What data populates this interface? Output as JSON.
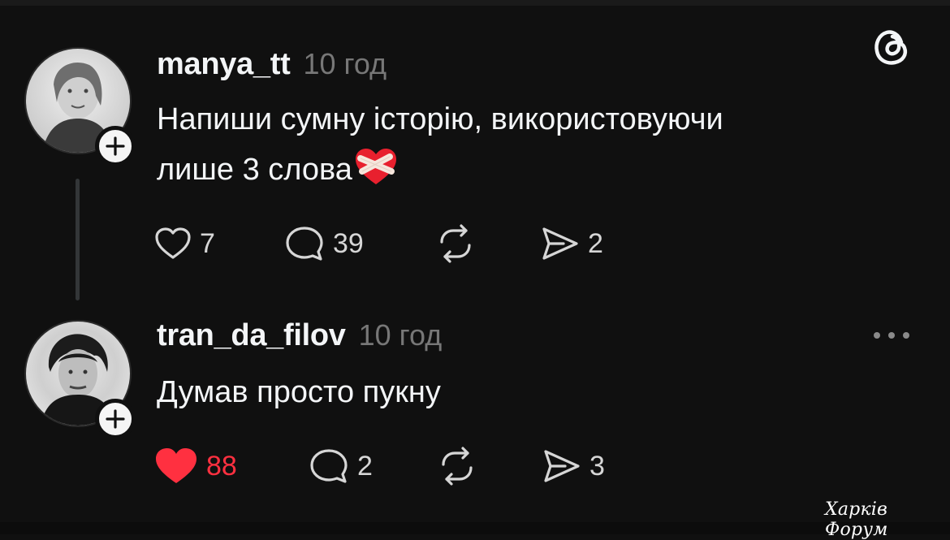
{
  "posts": [
    {
      "username": "manya_tt",
      "time": "10 год",
      "text_line1": "Напиши сумну історію, використовуючи",
      "text_line2": "лише 3 слова",
      "likes": "7",
      "replies": "39",
      "shares": "2",
      "liked": false
    },
    {
      "username": "tran_da_filov",
      "time": "10 год",
      "text": "Думав просто пукну",
      "likes": "88",
      "replies": "2",
      "shares": "3",
      "liked": true
    }
  ],
  "watermark": "Харків Форум",
  "colors": {
    "background": "#101010",
    "text": "#f3f5f7",
    "muted": "#777777",
    "like_active": "#ff3040"
  },
  "icons": [
    "threads-logo-icon",
    "heart-icon",
    "comment-icon",
    "repost-icon",
    "send-icon",
    "more-icon",
    "plus-icon",
    "mending-heart-emoji"
  ]
}
